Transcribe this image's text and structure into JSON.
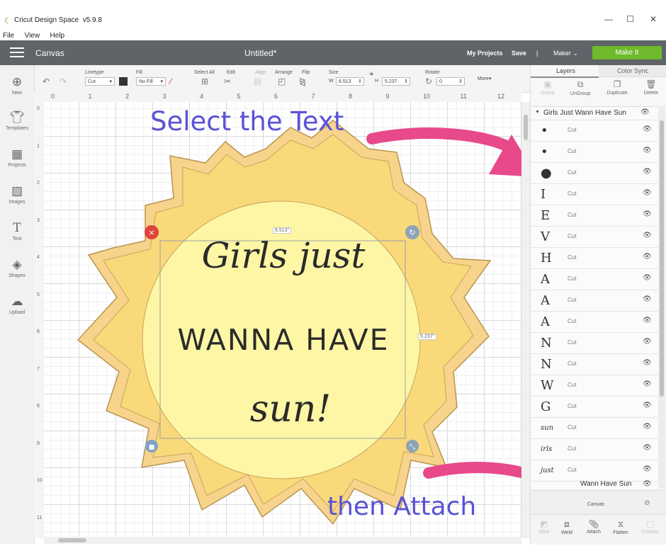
{
  "window": {
    "app_name": "Cricut Design Space",
    "version": "v5.9.8",
    "menus": [
      "File",
      "View",
      "Help"
    ]
  },
  "header": {
    "section": "Canvas",
    "document_title": "Untitled*",
    "my_projects": "My Projects",
    "save": "Save",
    "separator": "|",
    "machine": "Maker",
    "make_it": "Make It"
  },
  "toolbar": {
    "linetype_label": "Linetype",
    "linetype_value": "Cut",
    "fill_label": "Fill",
    "fill_value": "No Fill",
    "select_all_label": "Select All",
    "edit_label": "Edit",
    "align_label": "Align",
    "arrange_label": "Arrange",
    "flip_label": "Flip",
    "size_label": "Size",
    "width_prefix": "W",
    "width_value": "6.513",
    "height_prefix": "H",
    "height_value": "5.237",
    "rotate_label": "Rotate",
    "rotate_value": "0",
    "more_label": "More"
  },
  "sidebar": {
    "items": [
      {
        "label": "New",
        "icon": "plus-circle-icon"
      },
      {
        "label": "Templates",
        "icon": "tshirt-icon"
      },
      {
        "label": "Projects",
        "icon": "projects-grid-icon"
      },
      {
        "label": "Images",
        "icon": "image-icon"
      },
      {
        "label": "Text",
        "icon": "text-t-icon"
      },
      {
        "label": "Shapes",
        "icon": "shapes-icon"
      },
      {
        "label": "Upload",
        "icon": "cloud-upload-icon"
      }
    ]
  },
  "rulers": {
    "top": [
      "0",
      "1",
      "2",
      "3",
      "4",
      "5",
      "6",
      "7",
      "8",
      "9",
      "10",
      "11",
      "12"
    ],
    "left": [
      "0",
      "1",
      "2",
      "3",
      "4",
      "5",
      "6",
      "7",
      "8",
      "9",
      "10",
      "11"
    ]
  },
  "canvas": {
    "width_readout": "6.513\"",
    "height_readout": "5.237\""
  },
  "design": {
    "line1": "Girls just",
    "line2": "WANNA HAVE",
    "line3": "sun!"
  },
  "annotations": {
    "select": "Select the Text",
    "attach": "then Attach"
  },
  "colors": {
    "annotation_text": "#5a52d5",
    "arrow": "#e8498a",
    "sun_outer": "#f7d38b",
    "sun_rays": "#f9d97a",
    "sun_center": "#fdf6a4",
    "header_bg": "#5e6468",
    "make_it_bg": "#6fba2c"
  },
  "panel": {
    "tab_layers": "Layers",
    "tab_color_sync": "Color Sync",
    "actions": [
      "Group",
      "UnGroup",
      "Duplicate",
      "Delete"
    ],
    "group_name": "Girls Just Wann Have Sun",
    "layers": [
      {
        "glyph": "•",
        "op": "Cut"
      },
      {
        "glyph": "•",
        "op": "Cut"
      },
      {
        "glyph": "●",
        "op": "Cut"
      },
      {
        "glyph": "I",
        "op": "Cut"
      },
      {
        "glyph": "E",
        "op": "Cut"
      },
      {
        "glyph": "V",
        "op": "Cut"
      },
      {
        "glyph": "H",
        "op": "Cut"
      },
      {
        "glyph": "A",
        "op": "Cut"
      },
      {
        "glyph": "A",
        "op": "Cut"
      },
      {
        "glyph": "A",
        "op": "Cut"
      },
      {
        "glyph": "N",
        "op": "Cut"
      },
      {
        "glyph": "N",
        "op": "Cut"
      },
      {
        "glyph": "W",
        "op": "Cut"
      },
      {
        "glyph": "G",
        "op": "Cut"
      },
      {
        "glyph": "sun",
        "op": "Cut"
      },
      {
        "glyph": "irls",
        "op": "Cut"
      },
      {
        "glyph": "just",
        "op": "Cut"
      }
    ],
    "second_group_partial": "Wann Have Sun",
    "canvas_row_label": "Canvas",
    "bottom_actions": [
      {
        "label": "Slice",
        "enabled": false
      },
      {
        "label": "Weld",
        "enabled": true
      },
      {
        "label": "Attach",
        "enabled": true
      },
      {
        "label": "Flatten",
        "enabled": true
      },
      {
        "label": "Contour",
        "enabled": false
      }
    ]
  }
}
